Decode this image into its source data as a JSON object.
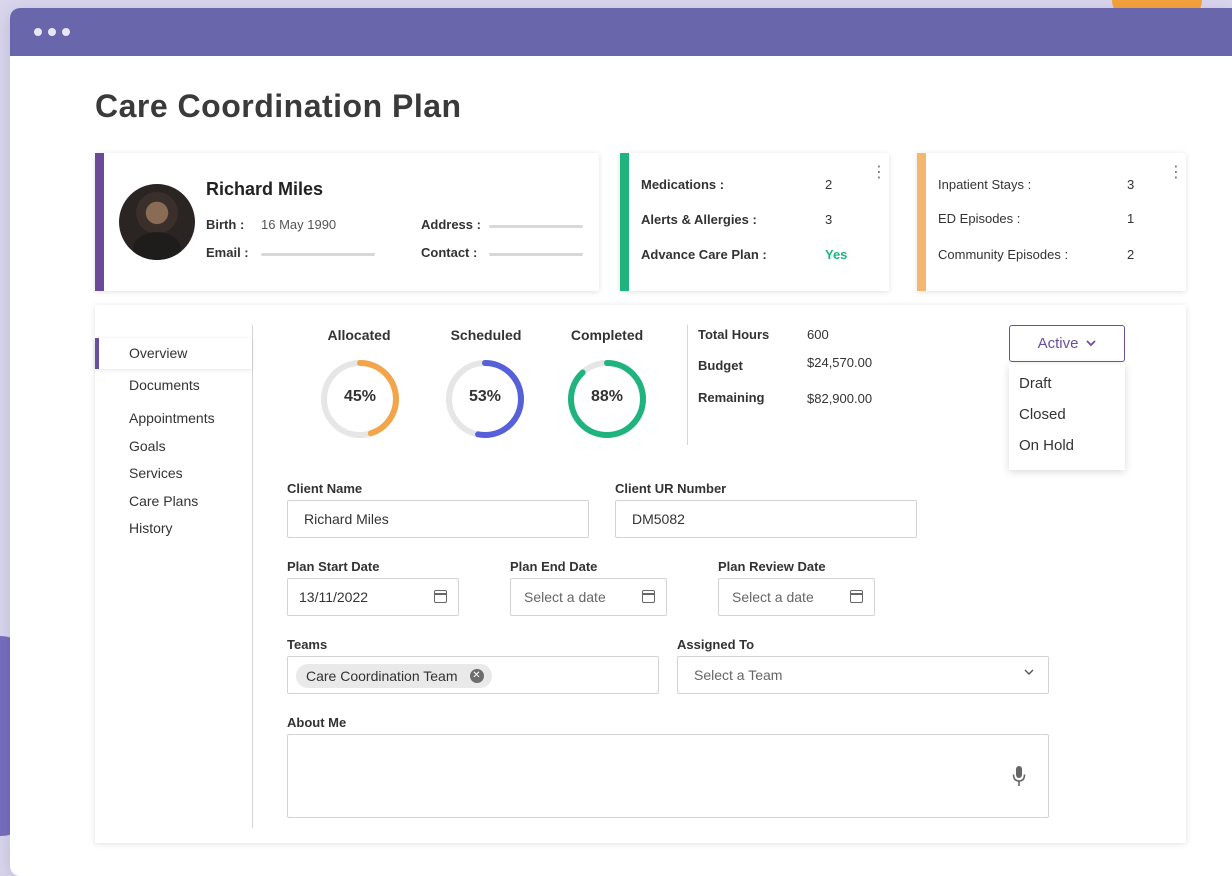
{
  "page": {
    "title": "Care Coordination Plan"
  },
  "patient": {
    "name": "Richard Miles",
    "birth_label": "Birth :",
    "birth_value": "16 May 1990",
    "email_label": "Email :",
    "address_label": "Address :",
    "contact_label": "Contact :"
  },
  "medical": {
    "rows": [
      {
        "label": "Medications :",
        "value": "2"
      },
      {
        "label": "Alerts & Allergies :",
        "value": "3"
      },
      {
        "label": "Advance Care Plan :",
        "value": "Yes"
      }
    ]
  },
  "stays": {
    "rows": [
      {
        "label": "Inpatient Stays :",
        "value": "3"
      },
      {
        "label": "ED Episodes :",
        "value": "1"
      },
      {
        "label": "Community Episodes :",
        "value": "2"
      }
    ]
  },
  "nav": {
    "items": [
      "Overview",
      "Documents",
      "Appointments",
      "Goals",
      "Services",
      "Care Plans",
      "History"
    ],
    "active": "Overview"
  },
  "progress": [
    {
      "label": "Allocated",
      "percent": 45,
      "text": "45%",
      "color": "#f2a54a"
    },
    {
      "label": "Scheduled",
      "percent": 53,
      "text": "53%",
      "color": "#5560d9"
    },
    {
      "label": "Completed",
      "percent": 88,
      "text": "88%",
      "color": "#1fb47e"
    }
  ],
  "summary": {
    "total_hours_label": "Total Hours",
    "total_hours_value": "600",
    "budget_label": "Budget",
    "budget_value": "$24,570.00",
    "remaining_label": "Remaining",
    "remaining_value": "$82,900.00"
  },
  "status": {
    "selected": "Active",
    "options": [
      "Draft",
      "Closed",
      "On Hold"
    ]
  },
  "form": {
    "client_name_label": "Client Name",
    "client_name_value": "Richard Miles",
    "client_ur_label": "Client UR Number",
    "client_ur_value": "DM5082",
    "start_date_label": "Plan Start Date",
    "start_date_value": "13/11/2022",
    "end_date_label": "Plan End Date",
    "end_date_placeholder": "Select a date",
    "review_date_label": "Plan Review Date",
    "review_date_placeholder": "Select a date",
    "teams_label": "Teams",
    "team_chip": "Care Coordination Team",
    "assigned_label": "Assigned To",
    "assigned_placeholder": "Select a Team",
    "about_label": "About Me",
    "about_value": ""
  },
  "colors": {
    "titlebar": "#6a66ab",
    "patient_accent": "#6b4b97",
    "medical_accent": "#1fb47e",
    "stays_accent": "#f3b86d",
    "brand": "#6a4fa0",
    "yes_green": "#1fb47e"
  },
  "icons": {
    "calendar": "calendar-icon",
    "microphone": "microphone-icon",
    "kebab": "kebab-menu-icon",
    "chevron": "chevron-down-icon",
    "clear": "close-circle-icon"
  }
}
